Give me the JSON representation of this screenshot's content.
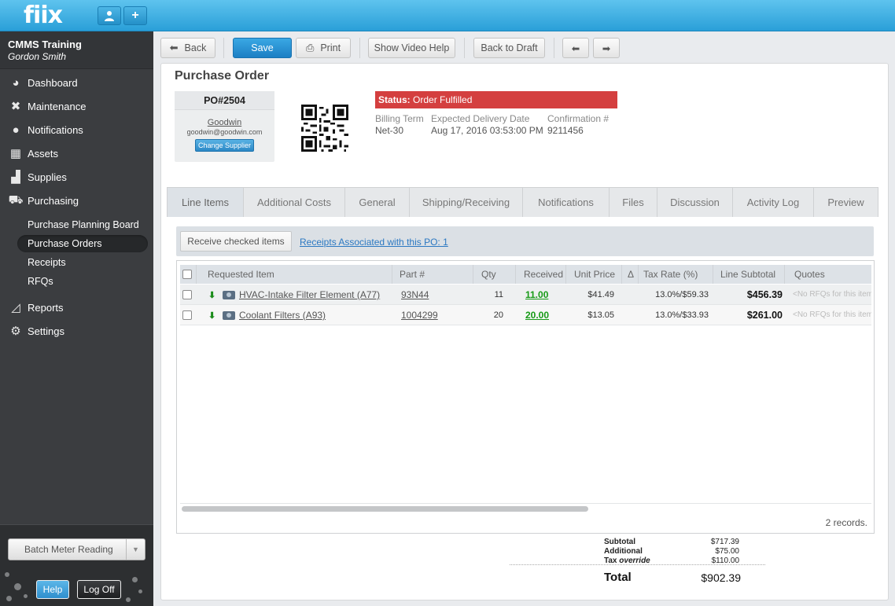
{
  "app": {
    "logo": "fiix"
  },
  "topbar": {
    "user_icon": "user-icon",
    "add_icon": "plus-icon"
  },
  "sidebar": {
    "org": "CMMS Training",
    "user": "Gordon Smith",
    "items": [
      {
        "label": "Dashboard",
        "icon": "dashboard-icon"
      },
      {
        "label": "Maintenance",
        "icon": "wrench-icon"
      },
      {
        "label": "Notifications",
        "icon": "chat-bubble-icon"
      },
      {
        "label": "Assets",
        "icon": "boxes-icon"
      },
      {
        "label": "Supplies",
        "icon": "truck-icon"
      },
      {
        "label": "Purchasing",
        "icon": "cart-icon"
      }
    ],
    "sub_items": [
      {
        "label": "Purchase Planning Board"
      },
      {
        "label": "Purchase Orders"
      },
      {
        "label": "Receipts"
      },
      {
        "label": "RFQs"
      }
    ],
    "bottom_items": [
      {
        "label": "Reports",
        "icon": "chart-icon"
      },
      {
        "label": "Settings",
        "icon": "gear-icon"
      }
    ],
    "batch_label": "Batch Meter Reading",
    "help_label": "Help",
    "logoff_label": "Log Off"
  },
  "toolbar": {
    "back": "Back",
    "save": "Save",
    "print": "Print",
    "video_help": "Show Video Help",
    "back_to_draft": "Back to Draft"
  },
  "po": {
    "title": "Purchase Order",
    "number": "PO#2504",
    "supplier_name": "Goodwin",
    "supplier_email": "goodwin@goodwin.com",
    "change_supplier": "Change Supplier",
    "status_label": "Status:",
    "status_value": "Order Fulfilled",
    "billing_term_label": "Billing Term",
    "billing_term": "Net-30",
    "delivery_label": "Expected Delivery Date",
    "delivery": "Aug 17, 2016 03:53:00 PM",
    "confirmation_label": "Confirmation #",
    "confirmation": "9211456"
  },
  "tabs": [
    "Line Items",
    "Additional Costs",
    "General",
    "Shipping/Receiving",
    "Notifications",
    "Files",
    "Discussion",
    "Activity Log",
    "Preview"
  ],
  "line_items": {
    "receive_btn": "Receive checked items",
    "receipts_link": "Receipts Associated with this PO: 1",
    "columns": [
      "Requested Item",
      "Part #",
      "Qty",
      "Received",
      "Unit Price",
      "Δ",
      "Tax Rate (%)",
      "Line Subtotal",
      "Quotes"
    ],
    "rows": [
      {
        "item": "HVAC-Intake Filter Element (A77)",
        "part": "93N44",
        "qty": "11",
        "received": "11.00",
        "unit_price": "$41.49",
        "tax": "13.0%/$59.33",
        "subtotal": "$456.39",
        "quotes": "<No RFQs for this item>"
      },
      {
        "item": "Coolant Filters (A93)",
        "part": "1004299",
        "qty": "20",
        "received": "20.00",
        "unit_price": "$13.05",
        "tax": "13.0%/$33.93",
        "subtotal": "$261.00",
        "quotes": "<No RFQs for this item>"
      }
    ],
    "records": "2 records."
  },
  "totals": {
    "subtotal_label": "Subtotal",
    "subtotal": "$717.39",
    "additional_label": "Additional",
    "additional": "$75.00",
    "tax_label": "Tax",
    "tax_override": "override",
    "tax": "$110.00",
    "total_label": "Total",
    "total": "$902.39"
  },
  "colors": {
    "accent": "#2a9fd8",
    "status": "#d43f3f",
    "received": "#169a16"
  }
}
